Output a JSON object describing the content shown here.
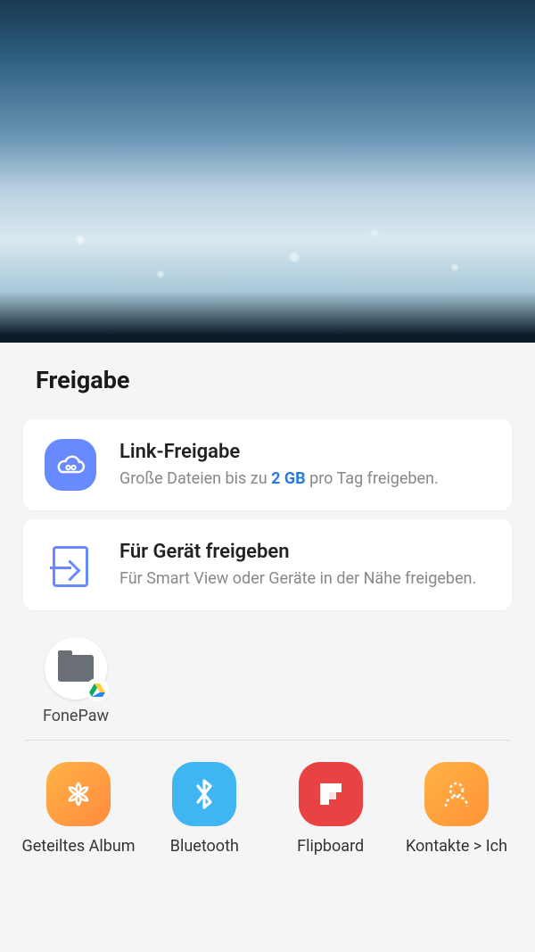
{
  "sheet": {
    "title": "Freigabe",
    "linkShare": {
      "title": "Link-Freigabe",
      "sub_before": "Große Dateien bis zu ",
      "sub_accent": "2 GB",
      "sub_after": " pro Tag freigeben."
    },
    "deviceShare": {
      "title": "Für Gerät freigeben",
      "sub": "Für Smart View oder Geräte in der Nähe freigeben."
    },
    "targets": [
      {
        "label": "FonePaw"
      }
    ],
    "apps": [
      {
        "label": "Geteiltes Album",
        "icon": "gallery"
      },
      {
        "label": "Bluetooth",
        "icon": "bluetooth"
      },
      {
        "label": "Flipboard",
        "icon": "flipboard"
      },
      {
        "label": "Kontakte > Ich",
        "icon": "contacts"
      }
    ]
  }
}
